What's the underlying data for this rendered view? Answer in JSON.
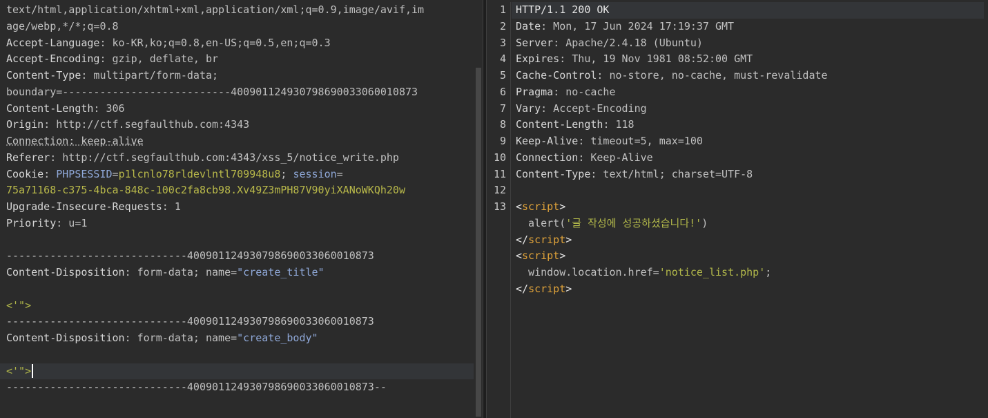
{
  "request": {
    "lines": [
      {
        "segs": [
          {
            "c": "v",
            "t": "text/html,application/xhtml+xml,application/xml;q=0.9,image/avif,im"
          }
        ]
      },
      {
        "segs": [
          {
            "c": "v",
            "t": "age/webp,*/*;q=0.8"
          }
        ]
      },
      {
        "segs": [
          {
            "c": "k",
            "t": "Accept-Language"
          },
          {
            "c": "v",
            "t": ": ko-KR,ko;q=0.8,en-US;q=0.5,en;q=0.3"
          }
        ]
      },
      {
        "segs": [
          {
            "c": "k",
            "t": "Accept-Encoding"
          },
          {
            "c": "v",
            "t": ": gzip, deflate, br"
          }
        ]
      },
      {
        "segs": [
          {
            "c": "k",
            "t": "Content-Type"
          },
          {
            "c": "v",
            "t": ": multipart/form-data;"
          }
        ]
      },
      {
        "segs": [
          {
            "c": "v",
            "t": "boundary=---------------------------400901124930798690033060010873"
          }
        ]
      },
      {
        "segs": [
          {
            "c": "k",
            "t": "Content-Length"
          },
          {
            "c": "v",
            "t": ": 306"
          }
        ]
      },
      {
        "segs": [
          {
            "c": "k",
            "t": "Origin"
          },
          {
            "c": "v",
            "t": ": http://ctf.segfaulthub.com:4343"
          }
        ]
      },
      {
        "segs": [
          {
            "c": "kd",
            "t": "Connection: keep-alive"
          }
        ]
      },
      {
        "segs": [
          {
            "c": "k",
            "t": "Referer"
          },
          {
            "c": "v",
            "t": ": http://ctf.segfaulthub.com:4343/xss_5/notice_write.php"
          }
        ]
      },
      {
        "segs": [
          {
            "c": "k",
            "t": "Cookie"
          },
          {
            "c": "v",
            "t": ": "
          },
          {
            "c": "b",
            "t": "PHPSESSID"
          },
          {
            "c": "v",
            "t": "="
          },
          {
            "c": "y",
            "t": "p1lcnlo78rldevlntl709948u8"
          },
          {
            "c": "v",
            "t": "; "
          },
          {
            "c": "b",
            "t": "session"
          },
          {
            "c": "v",
            "t": "="
          }
        ]
      },
      {
        "segs": [
          {
            "c": "y",
            "t": "75a71168-c375-4bca-848c-100c2fa8cb98.Xv49Z3mPH87V90yiXANoWKQh20w"
          }
        ]
      },
      {
        "segs": [
          {
            "c": "k",
            "t": "Upgrade-Insecure-Requests"
          },
          {
            "c": "v",
            "t": ": 1"
          }
        ]
      },
      {
        "segs": [
          {
            "c": "k",
            "t": "Priority"
          },
          {
            "c": "v",
            "t": ": u=1"
          }
        ]
      },
      {
        "segs": []
      },
      {
        "segs": [
          {
            "c": "v",
            "t": "-----------------------------400901124930798690033060010873"
          }
        ]
      },
      {
        "segs": [
          {
            "c": "k",
            "t": "Content-Disposition"
          },
          {
            "c": "v",
            "t": ": form-data; name="
          },
          {
            "c": "b",
            "t": "\"create_title\""
          }
        ]
      },
      {
        "segs": []
      },
      {
        "segs": [
          {
            "c": "g",
            "t": "<'\">"
          }
        ]
      },
      {
        "segs": [
          {
            "c": "v",
            "t": "-----------------------------400901124930798690033060010873"
          }
        ]
      },
      {
        "segs": [
          {
            "c": "k",
            "t": "Content-Disposition"
          },
          {
            "c": "v",
            "t": ": form-data; name="
          },
          {
            "c": "b",
            "t": "\"create_body\""
          }
        ]
      },
      {
        "segs": []
      },
      {
        "segs": [
          {
            "c": "g",
            "t": "<'\">"
          }
        ],
        "highlight": true,
        "caret": true
      },
      {
        "segs": [
          {
            "c": "v",
            "t": "-----------------------------400901124930798690033060010873--"
          }
        ]
      }
    ]
  },
  "response": {
    "line_numbers": [
      "1",
      "2",
      "3",
      "4",
      "5",
      "6",
      "7",
      "8",
      "9",
      "10",
      "11",
      "12",
      "13"
    ],
    "lines": [
      {
        "segs": [
          {
            "c": "w",
            "t": "HTTP/1.1 200 OK"
          }
        ],
        "highlight": true
      },
      {
        "segs": [
          {
            "c": "k",
            "t": "Date"
          },
          {
            "c": "v",
            "t": ": Mon, 17 Jun 2024 17:19:37 GMT"
          }
        ]
      },
      {
        "segs": [
          {
            "c": "k",
            "t": "Server"
          },
          {
            "c": "v",
            "t": ": Apache/2.4.18 (Ubuntu)"
          }
        ]
      },
      {
        "segs": [
          {
            "c": "k",
            "t": "Expires"
          },
          {
            "c": "v",
            "t": ": Thu, 19 Nov 1981 08:52:00 GMT"
          }
        ]
      },
      {
        "segs": [
          {
            "c": "k",
            "t": "Cache-Control"
          },
          {
            "c": "v",
            "t": ": no-store, no-cache, must-revalidate"
          }
        ]
      },
      {
        "segs": [
          {
            "c": "k",
            "t": "Pragma"
          },
          {
            "c": "v",
            "t": ": no-cache"
          }
        ]
      },
      {
        "segs": [
          {
            "c": "k",
            "t": "Vary"
          },
          {
            "c": "v",
            "t": ": Accept-Encoding"
          }
        ]
      },
      {
        "segs": [
          {
            "c": "k",
            "t": "Content-Length"
          },
          {
            "c": "v",
            "t": ": 118"
          }
        ]
      },
      {
        "segs": [
          {
            "c": "k",
            "t": "Keep-Alive"
          },
          {
            "c": "v",
            "t": ": timeout=5, max=100"
          }
        ]
      },
      {
        "segs": [
          {
            "c": "k",
            "t": "Connection"
          },
          {
            "c": "v",
            "t": ": Keep-Alive"
          }
        ]
      },
      {
        "segs": [
          {
            "c": "k",
            "t": "Content-Type"
          },
          {
            "c": "v",
            "t": ": text/html; charset=UTF-8"
          }
        ]
      },
      {
        "segs": []
      },
      {
        "segs": [
          {
            "c": "w",
            "t": "<"
          },
          {
            "c": "o",
            "t": "script"
          },
          {
            "c": "w",
            "t": ">"
          }
        ]
      },
      {
        "segs": [
          {
            "c": "v",
            "t": "  alert("
          },
          {
            "c": "g",
            "t": "'글 작성에 성공하셨습니다!'"
          },
          {
            "c": "v",
            "t": ")"
          }
        ]
      },
      {
        "segs": [
          {
            "c": "w",
            "t": "</"
          },
          {
            "c": "o",
            "t": "script"
          },
          {
            "c": "w",
            "t": ">"
          }
        ]
      },
      {
        "segs": [
          {
            "c": "w",
            "t": "<"
          },
          {
            "c": "o",
            "t": "script"
          },
          {
            "c": "w",
            "t": ">"
          }
        ]
      },
      {
        "segs": [
          {
            "c": "v",
            "t": "  window.location.href="
          },
          {
            "c": "g",
            "t": "'notice_list.php'"
          },
          {
            "c": "v",
            "t": ";"
          }
        ]
      },
      {
        "segs": [
          {
            "c": "w",
            "t": "</"
          },
          {
            "c": "o",
            "t": "script"
          },
          {
            "c": "w",
            "t": ">"
          }
        ]
      }
    ]
  }
}
